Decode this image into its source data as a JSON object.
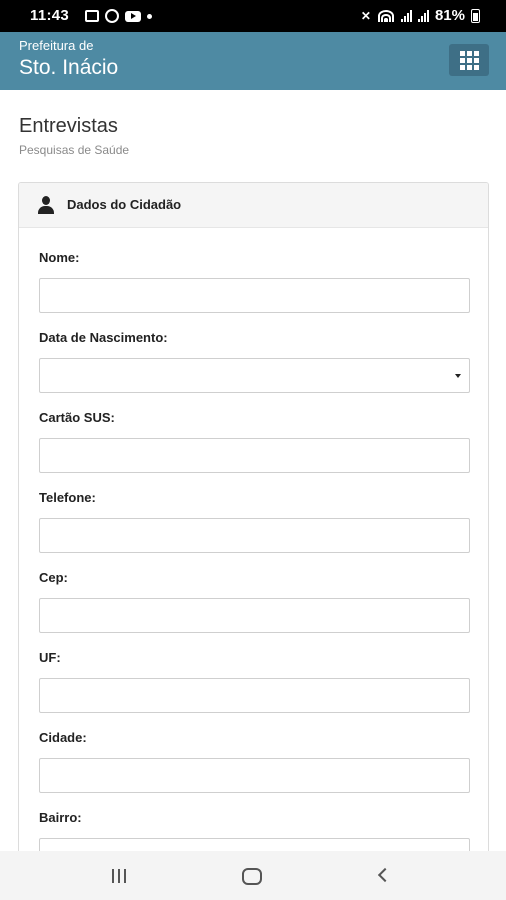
{
  "status_bar": {
    "time": "11:43",
    "battery": "81%",
    "icons": [
      "gallery-icon",
      "whatsapp-icon",
      "youtube-icon",
      "dot-icon",
      "mute-icon",
      "wifi-icon",
      "signal-icon",
      "battery-icon"
    ]
  },
  "app": {
    "subtitle": "Prefeitura de",
    "title": "Sto. Inácio",
    "menu_icon": "grid-icon",
    "header_color": "#4e8aa3"
  },
  "page": {
    "title": "Entrevistas",
    "subtitle": "Pesquisas de Saúde"
  },
  "panel": {
    "title": "Dados do Cidadão",
    "icon": "user-icon",
    "fields": [
      {
        "label": "Nome:",
        "value": "",
        "type": "text"
      },
      {
        "label": "Data de Nascimento:",
        "value": "",
        "type": "select"
      },
      {
        "label": "Cartão SUS:",
        "value": "",
        "type": "text"
      },
      {
        "label": "Telefone:",
        "value": "",
        "type": "text"
      },
      {
        "label": "Cep:",
        "value": "",
        "type": "text"
      },
      {
        "label": "UF:",
        "value": "",
        "type": "text"
      },
      {
        "label": "Cidade:",
        "value": "",
        "type": "text"
      },
      {
        "label": "Bairro:",
        "value": "",
        "type": "text"
      }
    ]
  },
  "nav_bar": {
    "icons": [
      "recent-apps-icon",
      "home-icon",
      "back-icon"
    ]
  }
}
